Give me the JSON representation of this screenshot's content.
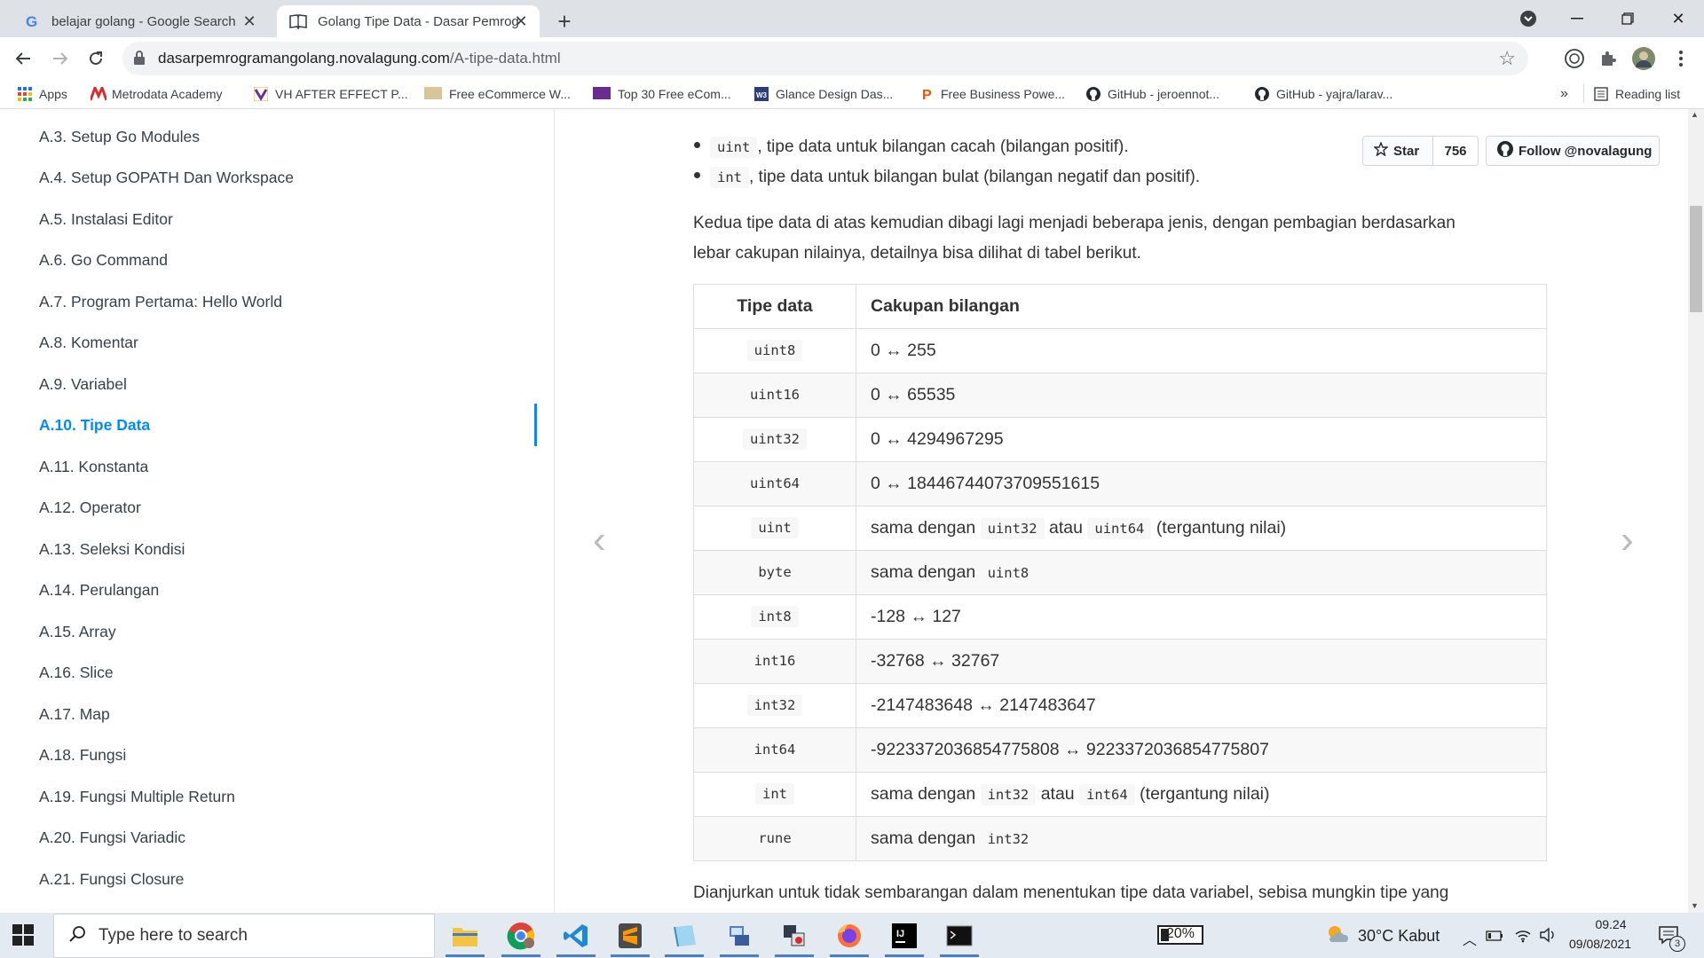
{
  "browser": {
    "tabs": [
      {
        "title": "belajar golang - Google Search",
        "icon": "google-icon",
        "active": false
      },
      {
        "title": "Golang Tipe Data - Dasar Pemrog",
        "icon": "book-icon",
        "active": true
      }
    ],
    "url_host": "dasarpemrogramangolang.novalagung.com",
    "url_path": "/A-tipe-data.html",
    "bookmarks": [
      "Apps",
      "Metrodata Academy",
      "VH AFTER EFFECT P...",
      "Free eCommerce W...",
      "Top 30 Free eCom...",
      "Glance Design Das...",
      "Free Business Powe...",
      "GitHub - jeroennot...",
      "GitHub - yajra/larav..."
    ],
    "bookmarks_more": "»",
    "reading_list": "Reading list"
  },
  "sidebar": {
    "items": [
      "A.3. Setup Go Modules",
      "A.4. Setup GOPATH Dan Workspace",
      "A.5. Instalasi Editor",
      "A.6. Go Command",
      "A.7. Program Pertama: Hello World",
      "A.8. Komentar",
      "A.9. Variabel",
      "A.10. Tipe Data",
      "A.11. Konstanta",
      "A.12. Operator",
      "A.13. Seleksi Kondisi",
      "A.14. Perulangan",
      "A.15. Array",
      "A.16. Slice",
      "A.17. Map",
      "A.18. Fungsi",
      "A.19. Fungsi Multiple Return",
      "A.20. Fungsi Variadic",
      "A.21. Fungsi Closure"
    ],
    "active_item": "A.10. Tipe Data"
  },
  "github": {
    "star_label": "Star",
    "star_count": "756",
    "follow_label": "Follow @novalagung"
  },
  "content": {
    "bullet1_code": "uint",
    "bullet1_text": ", tipe data untuk bilangan cacah (bilangan positif).",
    "bullet2_code": "int",
    "bullet2_text": ", tipe data untuk bilangan bulat (bilangan negatif dan positif).",
    "para1_line1": "Kedua tipe data di atas kemudian dibagi lagi menjadi beberapa jenis, dengan pembagian berdasarkan",
    "para1_line2": "lebar cakupan nilainya, detailnya bisa dilihat di tabel berikut.",
    "para2": "Dianjurkan untuk tidak sembarangan dalam menentukan tipe data variabel, sebisa mungkin tipe yang"
  },
  "table": {
    "header_type": "Tipe data",
    "header_range": "Cakupan bilangan",
    "rows": [
      {
        "type": "uint8",
        "range": "0 ↔ 255"
      },
      {
        "type": "uint16",
        "range": "0 ↔ 65535"
      },
      {
        "type": "uint32",
        "range": "0 ↔ 4294967295"
      },
      {
        "type": "uint64",
        "range": "0 ↔ 18446744073709551615"
      },
      {
        "type": "uint",
        "pre": "sama dengan",
        "code1": "uint32",
        "mid": "atau",
        "code2": "uint64",
        "post": "(tergantung nilai)"
      },
      {
        "type": "byte",
        "pre": "sama dengan",
        "code1": "uint8"
      },
      {
        "type": "int8",
        "range": "-128 ↔ 127"
      },
      {
        "type": "int16",
        "range": "-32768 ↔ 32767"
      },
      {
        "type": "int32",
        "range": "-2147483648 ↔ 2147483647"
      },
      {
        "type": "int64",
        "range": "-9223372036854775808 ↔ 9223372036854775807"
      },
      {
        "type": "int",
        "pre": "sama dengan",
        "code1": "int32",
        "mid": "atau",
        "code2": "int64",
        "post": "(tergantung nilai)"
      },
      {
        "type": "rune",
        "pre": "sama dengan",
        "code1": "int32"
      }
    ]
  },
  "nav": {
    "prev": "‹",
    "next": "›"
  },
  "taskbar": {
    "search_placeholder": "Type here to search",
    "battery_percent": "20%",
    "weather": "30°C  Kabut",
    "time": "09.24",
    "date": "09/08/2021",
    "notification_count": "3"
  }
}
